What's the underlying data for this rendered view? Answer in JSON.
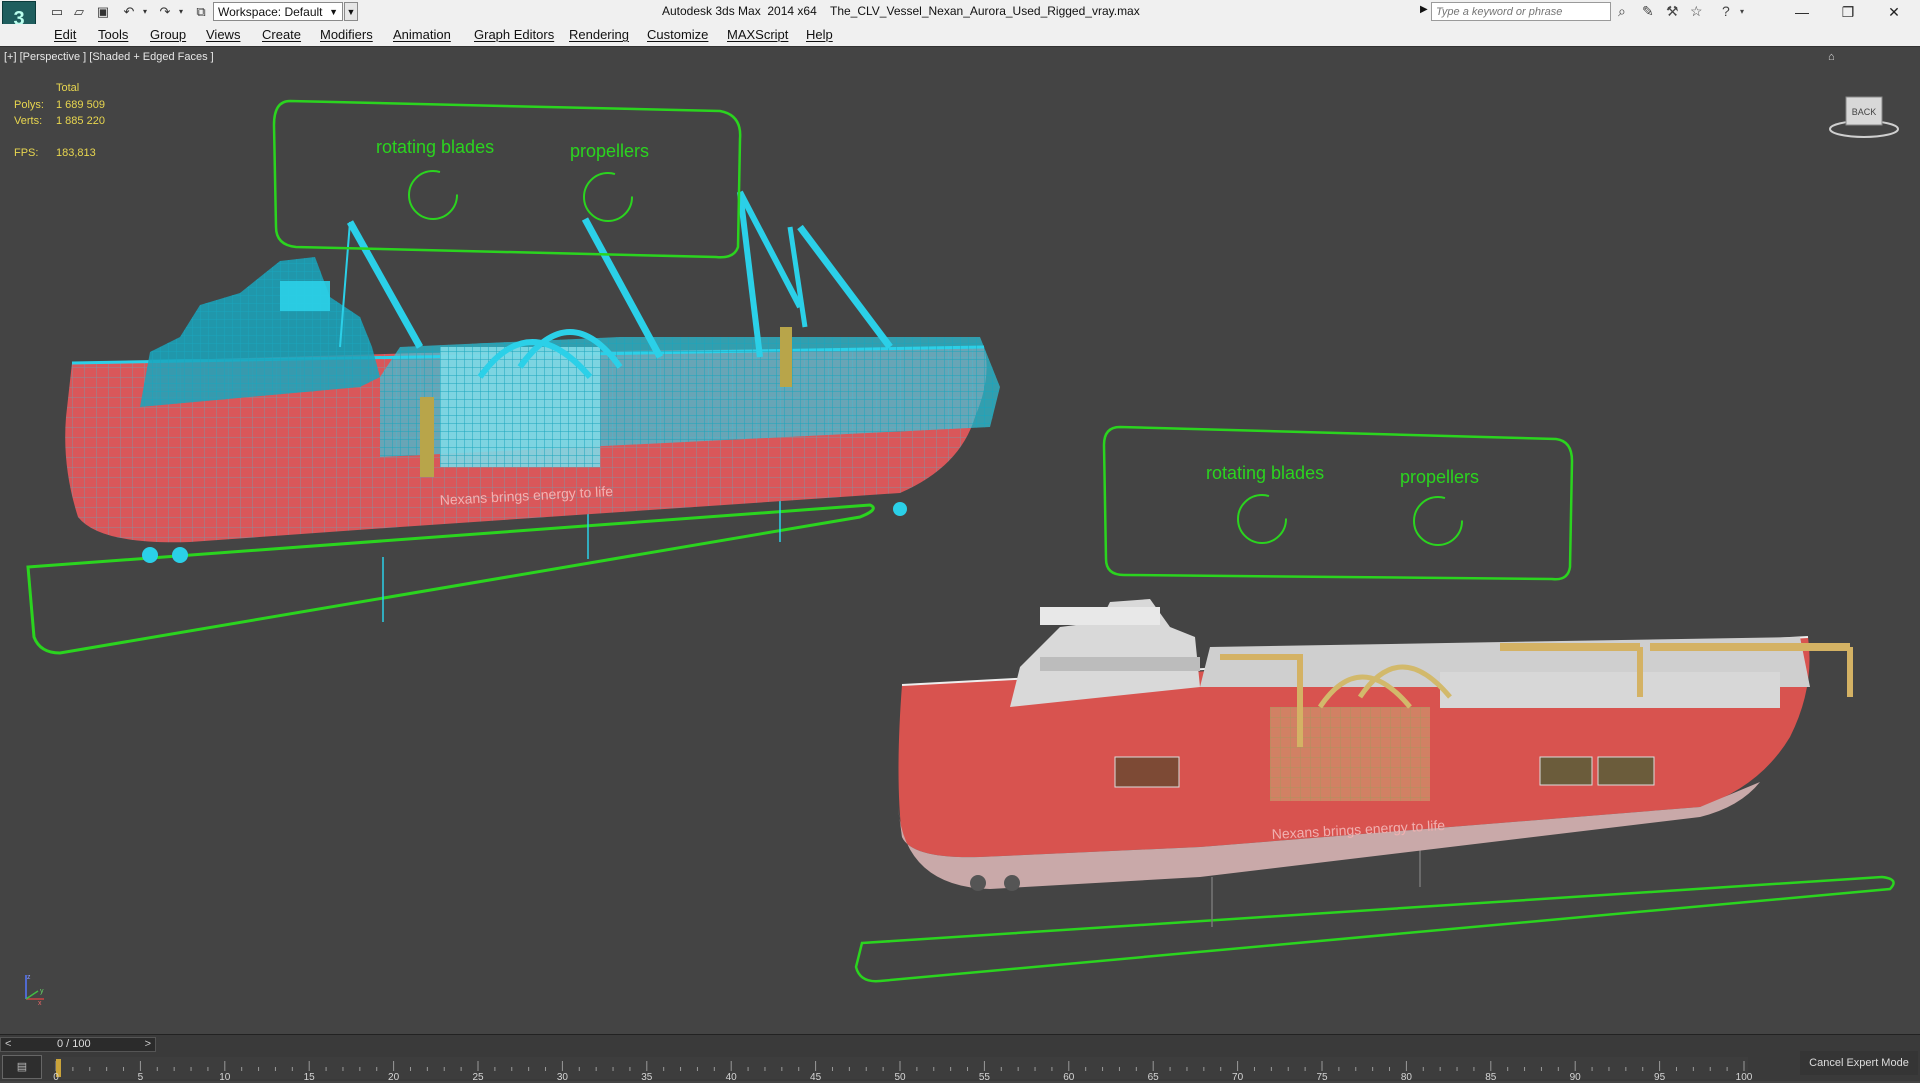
{
  "titlebar": {
    "app_title": "Autodesk 3ds Max  2014 x64",
    "file_name": "The_CLV_Vessel_Nexan_Aurora_Used_Rigged_vray.max",
    "workspace_label": "Workspace: Default",
    "search_placeholder": "Type a keyword or phrase"
  },
  "menu": {
    "items": [
      "Edit",
      "Tools",
      "Group",
      "Views",
      "Create",
      "Modifiers",
      "Animation",
      "Graph Editors",
      "Rendering",
      "Customize",
      "MAXScript",
      "Help"
    ]
  },
  "viewport": {
    "label": "[+] [Perspective ] [Shaded + Edged Faces ]",
    "stats": {
      "header": "Total",
      "polys_label": "Polys:",
      "polys_value": "1 689 509",
      "verts_label": "Verts:",
      "verts_value": "1 885 220",
      "fps_label": "FPS:",
      "fps_value": "183,813"
    },
    "viewcube_label": "BACK",
    "callouts": [
      {
        "rotating": "rotating blades",
        "propellers": "propellers"
      },
      {
        "rotating": "rotating blades",
        "propellers": "propellers"
      }
    ],
    "hull_text": [
      "Nexans brings energy to life",
      "Nexans brings energy to life"
    ],
    "colors": {
      "wire": "#2bd0e8",
      "hull": "#e05a5a",
      "helper": "#2bd41f"
    }
  },
  "timeline": {
    "slider_value": "0 / 100",
    "ticks": [
      "0",
      "5",
      "10",
      "15",
      "20",
      "25",
      "30",
      "35",
      "40",
      "45",
      "50",
      "55",
      "60",
      "65",
      "70",
      "75",
      "80",
      "85",
      "90",
      "95",
      "100"
    ],
    "cancel_expert": "Cancel Expert Mode"
  }
}
